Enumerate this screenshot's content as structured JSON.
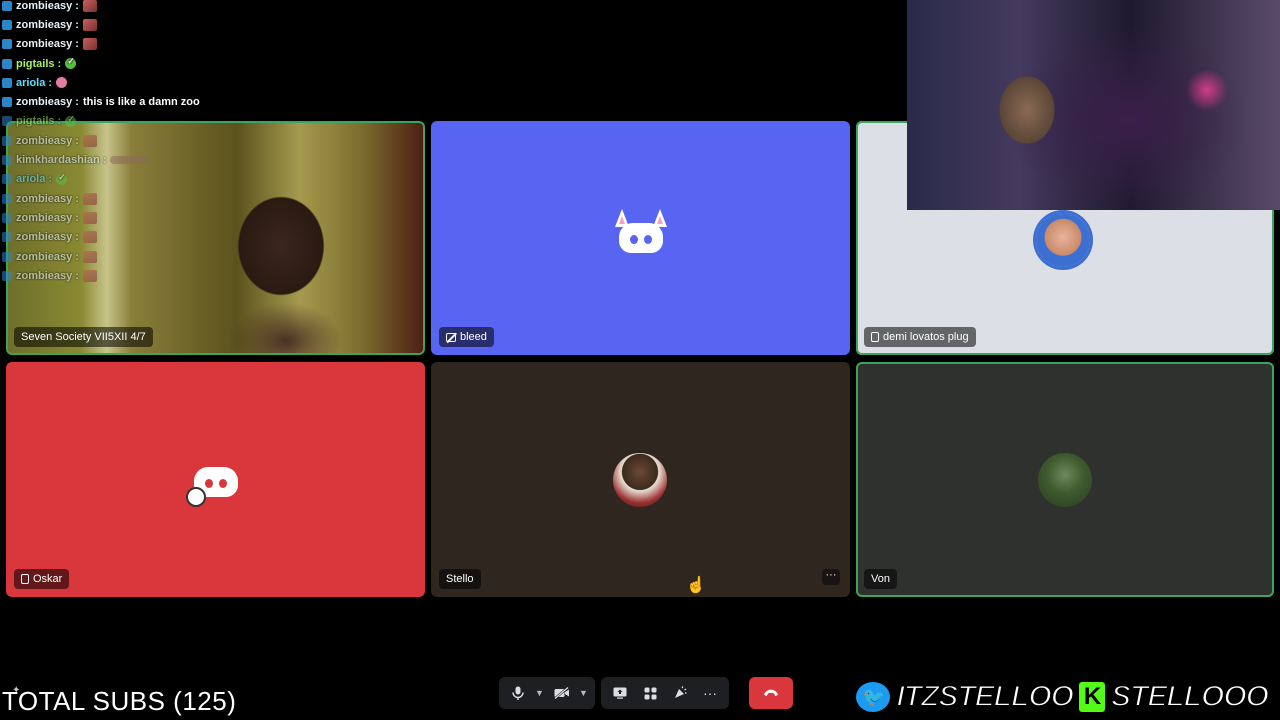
{
  "chat": {
    "lines": [
      {
        "user": "zombieasy :",
        "msg": "",
        "emote": "emote",
        "color": "",
        "faded": false
      },
      {
        "user": "zombieasy :",
        "msg": "",
        "emote": "emote",
        "color": "",
        "faded": false
      },
      {
        "user": "zombieasy :",
        "msg": "",
        "emote": "emote",
        "color": "",
        "faded": false
      },
      {
        "user": "pigtails :",
        "msg": "",
        "emote": "check",
        "color": "lime",
        "faded": false
      },
      {
        "user": "ariola :",
        "msg": "",
        "emote": "pink",
        "color": "cyan",
        "faded": false
      },
      {
        "user": "zombieasy :",
        "msg": "this is like a damn zoo",
        "emote": "",
        "color": "",
        "faded": false
      },
      {
        "user": "pigtails :",
        "msg": "",
        "emote": "check",
        "color": "lime",
        "faded": true
      },
      {
        "user": "zombieasy :",
        "msg": "",
        "emote": "emote",
        "color": "",
        "faded": true
      },
      {
        "user": "kimkhardashian :",
        "msg": "",
        "emote": "long",
        "color": "",
        "faded": true
      },
      {
        "user": "ariola :",
        "msg": "",
        "emote": "check",
        "color": "cyan",
        "faded": true
      },
      {
        "user": "zombieasy :",
        "msg": "",
        "emote": "emote",
        "color": "",
        "faded": true
      },
      {
        "user": "zombieasy :",
        "msg": "",
        "emote": "emote",
        "color": "",
        "faded": true
      },
      {
        "user": "zombieasy :",
        "msg": "",
        "emote": "emote",
        "color": "",
        "faded": true
      },
      {
        "user": "zombieasy :",
        "msg": "",
        "emote": "emote",
        "color": "",
        "faded": true
      },
      {
        "user": "zombieasy :",
        "msg": "",
        "emote": "emote",
        "color": "",
        "faded": true
      }
    ]
  },
  "tiles": {
    "seven": {
      "label": "Seven Society VII5XII 4/7"
    },
    "bleed": {
      "label": "bleed",
      "bg": "#5865f2"
    },
    "demi": {
      "label": "demi lovatos plug",
      "bg": "#dcdfe6"
    },
    "oskar": {
      "label": "Oskar",
      "bg": "#da373c"
    },
    "stello": {
      "label": "Stello",
      "bg": "#2e261f",
      "menu": "···"
    },
    "von": {
      "label": "Von",
      "bg": "#2f312f"
    }
  },
  "overlay": {
    "total_subs": "TOTAL SUBS (125)",
    "twitter_handle": "ITZSTELLOO",
    "kick_handle": "STELLOOO"
  },
  "controls": {
    "microphone_icon": "mic-icon",
    "camera_icon": "camera-off-icon",
    "share_icon": "screen-share-icon",
    "activities_icon": "activities-icon",
    "soundboard_icon": "soundboard-icon",
    "more_label": "···",
    "hangup_icon": "phone-hangup-icon"
  },
  "colors": {
    "accent_blurple": "#5865f2",
    "danger_red": "#da373c",
    "speaking_green": "#3ba55c"
  }
}
